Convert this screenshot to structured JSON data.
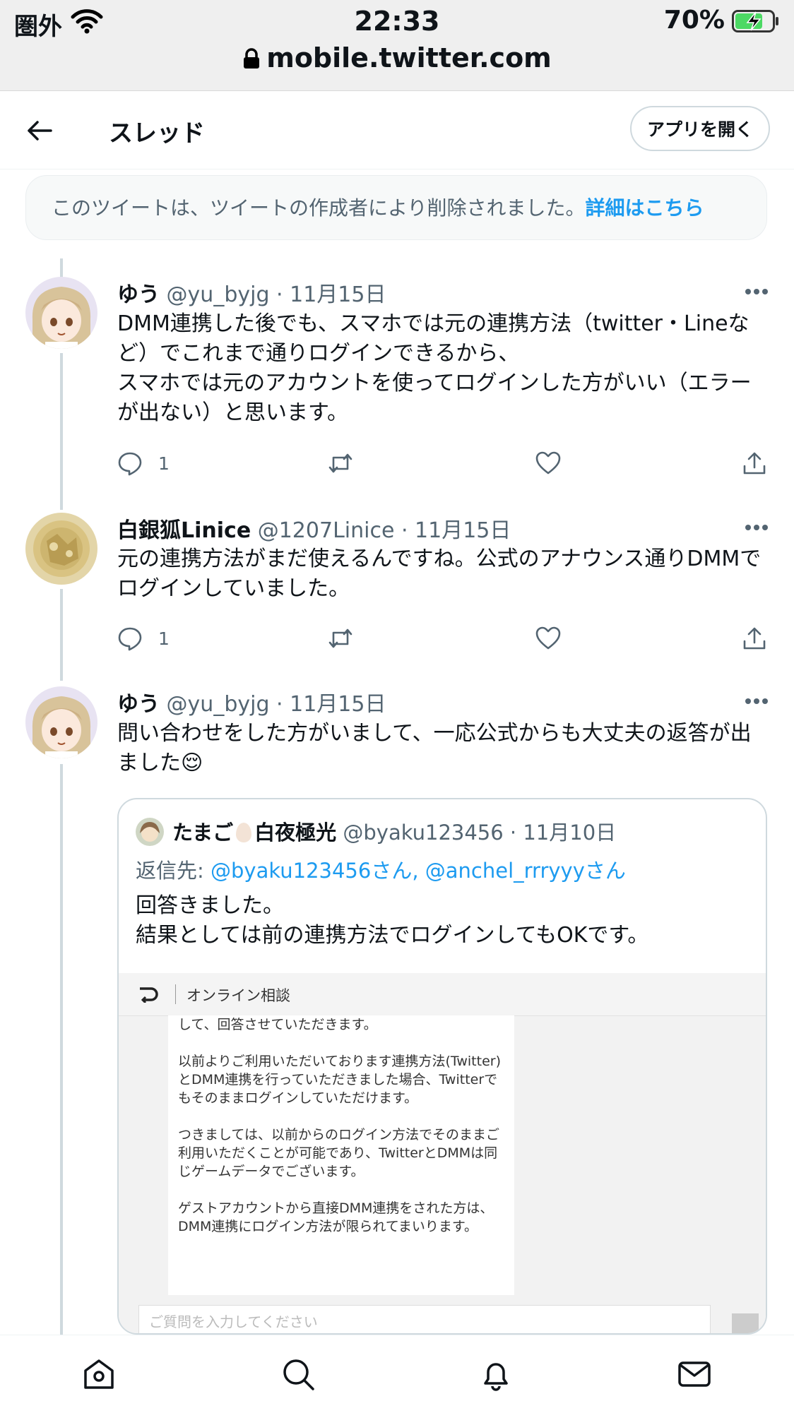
{
  "status_bar": {
    "carrier": "圏外",
    "time": "22:33",
    "battery": "70%",
    "url": "mobile.twitter.com"
  },
  "header": {
    "title": "スレッド",
    "open_app": "アプリを開く"
  },
  "deleted_notice": {
    "text": "このツイートは、ツイートの作成者により削除されました。",
    "link": "詳細はこちら"
  },
  "tweets": [
    {
      "name": "ゆう",
      "handle": "@yu_byjg",
      "date": "· 11月15日",
      "text": "DMM連携した後でも、スマホでは元の連携方法（twitter・Lineなど）でこれまで通りログインできるから、\nスマホでは元のアカウントを使ってログインした方がいい（エラーが出ない）と思います。",
      "replies": "1"
    },
    {
      "name": "白銀狐Linice",
      "handle": "@1207Linice",
      "date": "· 11月15日",
      "text": "元の連携方法がまだ使えるんですね。公式のアナウンス通りDMMでログインしていました。",
      "replies": "1"
    },
    {
      "name": "ゆう",
      "handle": "@yu_byjg",
      "date": "· 11月15日",
      "text": "問い合わせをした方がいまして、一応公式からも大丈夫の返答が出ました😌"
    }
  ],
  "quote": {
    "name_a": "たまご",
    "name_b": "白夜極光",
    "handle": "@byaku123456",
    "date": "· 11月10日",
    "reply_label": "返信先: ",
    "reply_mentions": "@byaku123456さん, @anchel_rrryyyさん",
    "text": "回答きました。\n結果としては前の連携方法でログインしてもOKです。",
    "screenshot": {
      "title": "オンライン相談",
      "body": "して、回答させていただきます。\n\n以前よりご利用いただいております連携方法(Twitter)とDMM連携を行っていただきました場合、Twitterでもそのままログインしていただけます。\n\nつきましては、以前からのログイン方法でそのままご利用いただくことが可能であり、TwitterとDMMは同じゲームデータでございます。\n\nゲストアカウントから直接DMM連携をされた方は、DMM連携にログイン方法が限られてまいります。",
      "input_placeholder": "ご質問を入力してください"
    }
  },
  "colors": {
    "accent": "#1d9bf0",
    "secondary_text": "#536471",
    "thread_line": "#cfd9de"
  }
}
